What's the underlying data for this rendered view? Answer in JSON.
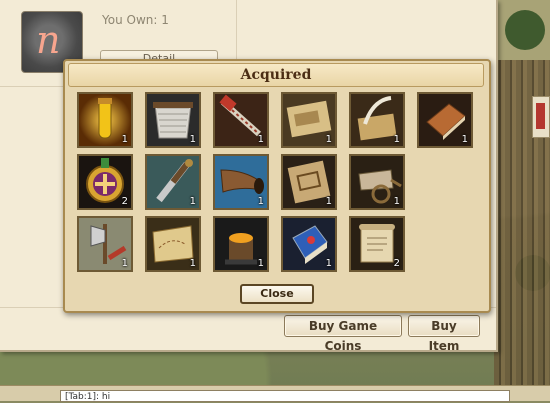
{
  "shop": {
    "you_own": "You Own: 1",
    "detail_label": "Detail",
    "buy_game_coins": "Buy Game Coins",
    "buy_item": "Buy Item"
  },
  "dialog": {
    "title": "Acquired",
    "close_label": "Close",
    "items": [
      {
        "name": "elixir-vial",
        "count": "1"
      },
      {
        "name": "chainmail-armor",
        "count": "1"
      },
      {
        "name": "hand-saw",
        "count": "1"
      },
      {
        "name": "blueprint-scroll",
        "count": "1"
      },
      {
        "name": "quill-and-parchment",
        "count": "1"
      },
      {
        "name": "leather-book",
        "count": "1"
      },
      {
        "name": "medal-pendant",
        "count": "2"
      },
      {
        "name": "dagger",
        "count": "1"
      },
      {
        "name": "war-horn",
        "count": "1"
      },
      {
        "name": "building-plan",
        "count": "1"
      },
      {
        "name": "handcart",
        "count": "1"
      },
      {
        "name": "axe-and-map",
        "count": "1"
      },
      {
        "name": "treasure-map",
        "count": "1"
      },
      {
        "name": "forge-anvil",
        "count": "1"
      },
      {
        "name": "blue-tome",
        "count": "1"
      },
      {
        "name": "parchment-scroll",
        "count": "2"
      }
    ]
  },
  "chat": {
    "input_value": "[Tab:1]: hi"
  }
}
